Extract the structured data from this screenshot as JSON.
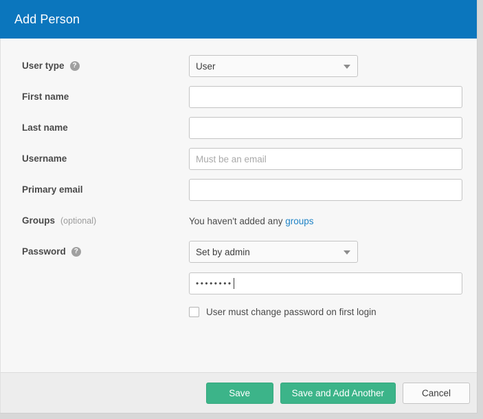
{
  "header": {
    "title": "Add Person",
    "background_color": "#0b76bd"
  },
  "form": {
    "user_type": {
      "label": "User type",
      "help_icon": "help-icon",
      "value": "User"
    },
    "first_name": {
      "label": "First name",
      "value": "",
      "placeholder": ""
    },
    "last_name": {
      "label": "Last name",
      "value": "",
      "placeholder": ""
    },
    "username": {
      "label": "Username",
      "value": "",
      "placeholder": "Must be an email"
    },
    "primary_email": {
      "label": "Primary email",
      "value": "",
      "placeholder": ""
    },
    "groups": {
      "label": "Groups",
      "optional_note": "(optional)",
      "empty_text": "You haven't added any",
      "link_text": "groups",
      "link_color": "#1f83c6"
    },
    "password": {
      "label": "Password",
      "help_icon": "help-icon",
      "mode_value": "Set by admin",
      "value_mask": "••••••••",
      "checkbox_label": "User must change password on first login",
      "checkbox_checked": false
    }
  },
  "footer": {
    "save_label": "Save",
    "save_add_another_label": "Save and Add Another",
    "cancel_label": "Cancel",
    "primary_color": "#3cb489"
  },
  "icons": {
    "dropdown_arrow": "chevron-down-icon",
    "help": "help-icon"
  }
}
